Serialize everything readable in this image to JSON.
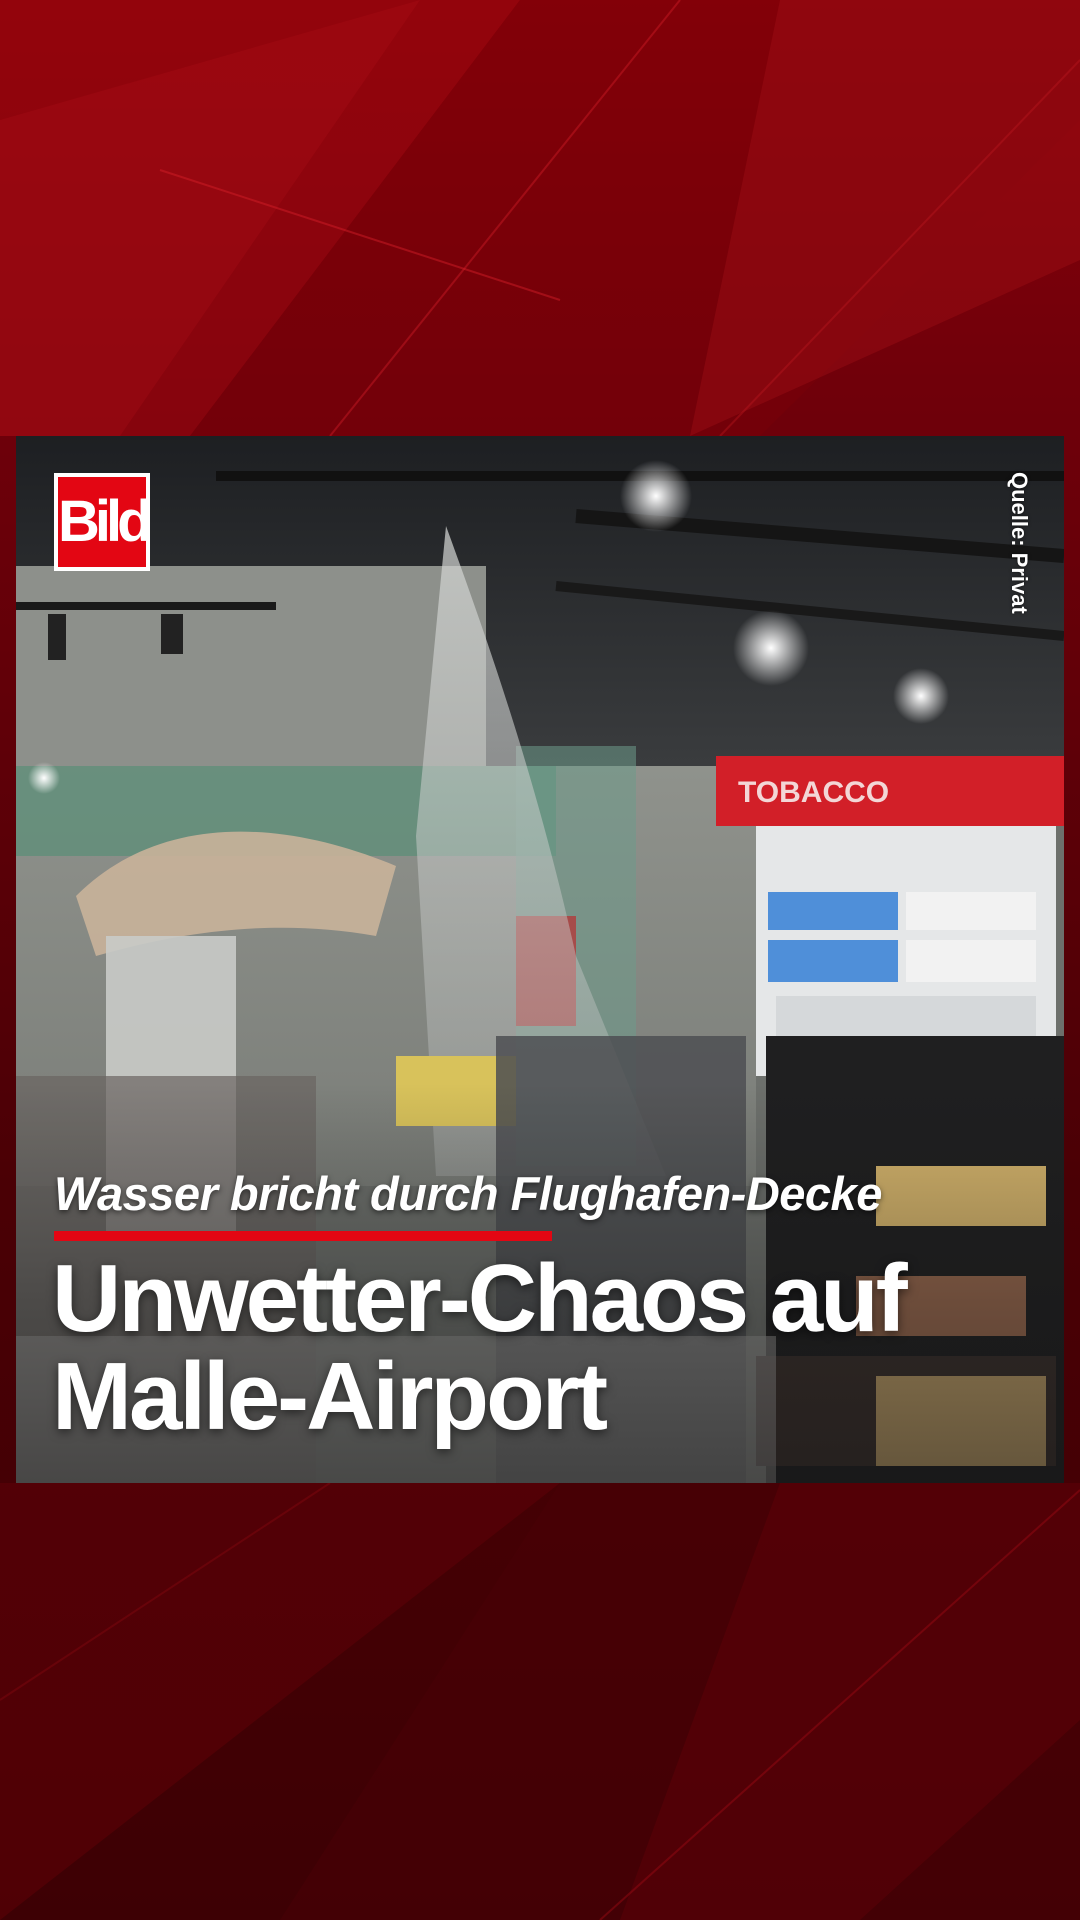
{
  "logo": {
    "text": "Bild",
    "color": "#e30613"
  },
  "video": {
    "source_label": "Quelle: Privat",
    "scene_description_icon": "video-still"
  },
  "store_sign": {
    "text": "TOBACCO",
    "color": "#d81f26"
  },
  "story": {
    "kicker": "Wasser bricht durch Flughafen-Decke",
    "headline_line1": "Unwetter-Chaos auf",
    "headline_line2": "Malle-Airport"
  },
  "theme": {
    "accent": "#e30613",
    "background": "#70000a"
  }
}
